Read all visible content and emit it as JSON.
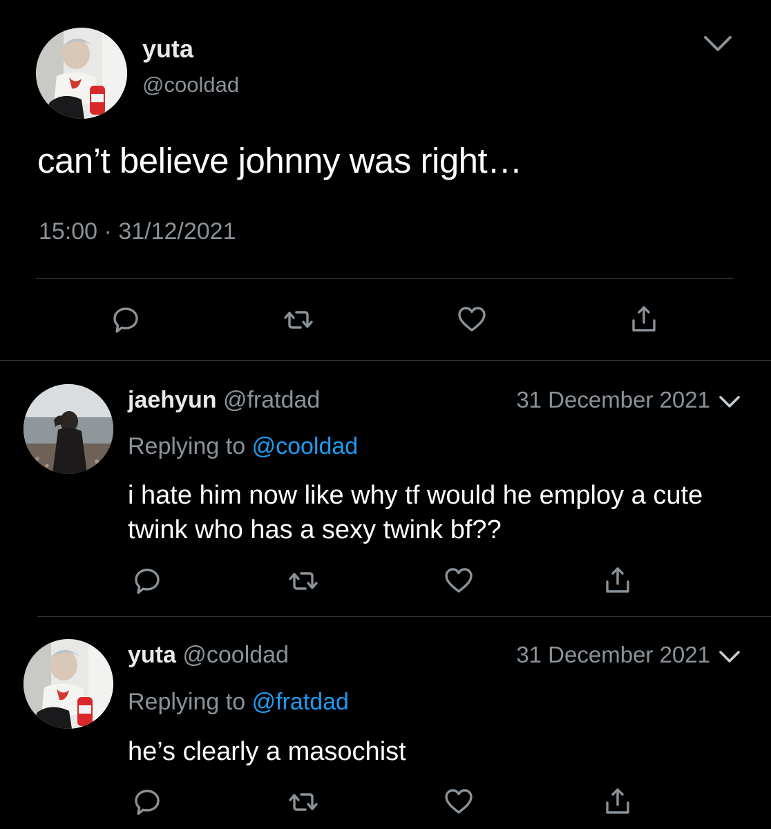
{
  "main_tweet": {
    "author_name": "yuta",
    "author_handle": "@cooldad",
    "text": "can’t believe johnny was right…",
    "time": "15:00",
    "separator": "·",
    "date": "31/12/2021",
    "icons": [
      "reply-icon",
      "retweet-icon",
      "like-icon",
      "share-icon",
      "chevron-down-icon"
    ]
  },
  "replies": [
    {
      "author_name": "jaehyun",
      "author_handle": "@fratdad",
      "date": "31 December 2021",
      "replying_to_label": "Replying to",
      "replying_to_handle": "@cooldad",
      "text": "i hate him now like why tf would he employ a cute twink who has a sexy twink bf??"
    },
    {
      "author_name": "yuta",
      "author_handle": "@cooldad",
      "date": "31 December 2021",
      "replying_to_label": "Replying to",
      "replying_to_handle": "@fratdad",
      "text": "he’s clearly a masochist"
    }
  ],
  "colors": {
    "background": "#000000",
    "text_primary": "#e7e9ea",
    "text_secondary": "#8b9298",
    "link": "#1d9bf0",
    "divider": "#2f3336"
  }
}
